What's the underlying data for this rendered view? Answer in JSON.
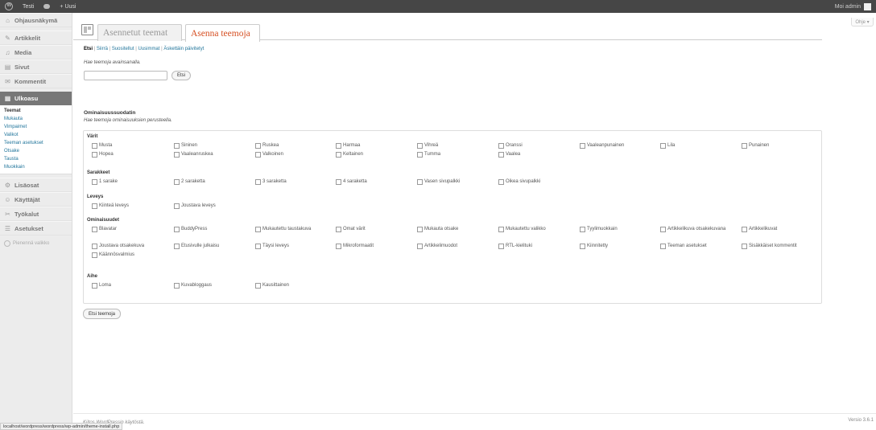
{
  "adminbar": {
    "site_name": "Testi",
    "new_label": "+ Uusi",
    "greeting": "Moi admin"
  },
  "help_tab": "Ohje ▾",
  "sidebar": {
    "items": [
      {
        "label": "Ohjausnäkymä",
        "icon": "dashboard-icon",
        "glyph": "⌂"
      },
      {
        "label": "Artikkelit",
        "icon": "pin-icon",
        "glyph": "✎"
      },
      {
        "label": "Media",
        "icon": "media-icon",
        "glyph": "♫"
      },
      {
        "label": "Sivut",
        "icon": "pages-icon",
        "glyph": "▤"
      },
      {
        "label": "Kommentit",
        "icon": "comments-icon",
        "glyph": "✉"
      },
      {
        "label": "Ulkoasu",
        "icon": "appearance-icon",
        "glyph": "▦"
      },
      {
        "label": "Lisäosat",
        "icon": "plugins-icon",
        "glyph": "⚙"
      },
      {
        "label": "Käyttäjät",
        "icon": "users-icon",
        "glyph": "☺"
      },
      {
        "label": "Työkalut",
        "icon": "tools-icon",
        "glyph": "✂"
      },
      {
        "label": "Asetukset",
        "icon": "settings-icon",
        "glyph": "☰"
      }
    ],
    "submenu": [
      "Teemat",
      "Mukauta",
      "Vimpaimet",
      "Valikot",
      "Teeman asetukset",
      "Otsake",
      "Tausta",
      "Muokkain"
    ],
    "collapse_label": "Pienennä valikko"
  },
  "tabs": {
    "installed": "Asennetut teemat",
    "install": "Asenna teemoja"
  },
  "subnav": {
    "items": [
      "Etsi",
      "Siirrä",
      "Suositellut",
      "Uusimmat",
      "Äskettäin päivitetyt"
    ],
    "separator": " | "
  },
  "search": {
    "hint": "Hae teemoja avainsanalla.",
    "value": "",
    "button": "Etsi"
  },
  "filter": {
    "heading": "Ominaisuussuodatin",
    "hint": "Hae teemoja ominaisuuksien perusteella.",
    "groups": [
      {
        "title": "Värit",
        "options": [
          "Musta",
          "Sininen",
          "Ruskea",
          "Harmaa",
          "Vihreä",
          "Oranssi",
          "Vaaleanpunainen",
          "Lila",
          "Punainen",
          "Hopea",
          "Vaaleanruskea",
          "Valkoinen",
          "Keltainen",
          "Tumma",
          "Vaalea"
        ]
      },
      {
        "title": "Sarakkeet",
        "options": [
          "1 sarake",
          "2 saraketta",
          "3 saraketta",
          "4 saraketta",
          "Vasen sivupalkki",
          "Oikea sivupalkki"
        ]
      },
      {
        "title": "Leveys",
        "options": [
          "Kiinteä leveys",
          "Joustava leveys"
        ]
      },
      {
        "title": "Ominaisuudet",
        "options": [
          "Blavatar",
          "BuddyPress",
          "Mukautettu taustakuva",
          "Omat värit",
          "Mukauta otsake",
          "Mukautettu valikko",
          "Tyylimuokkain",
          "Artikkelikuva otsakekuvana",
          "Artikkelikuvat",
          "Joustava otsakekuva",
          "Etusivulle julkaisu",
          "Täysi leveys",
          "Mikroformaatit",
          "Artikkelimuodot",
          "RTL-kielituki",
          "Kiinnitetty",
          "Teeman asetukset",
          "Sisäkkäiset kommentit",
          "Käännösvalmius"
        ]
      },
      {
        "title": "Aihe",
        "options": [
          "Loma",
          "Kuvabloggaus",
          "Kausittainen"
        ]
      }
    ],
    "submit": "Etsi teemoja"
  },
  "footer": {
    "left": "Kiitos WordPressin käytöstä.",
    "right": "Versio 3.6.1"
  },
  "statusbar": "localhost/wordpress/wordpress/wp-admin/theme-install.php",
  "colors": {
    "adminbar_bg": "#464646",
    "active_menu_bg": "#777777",
    "link": "#21759b",
    "active_tab_text": "#d54e21"
  }
}
